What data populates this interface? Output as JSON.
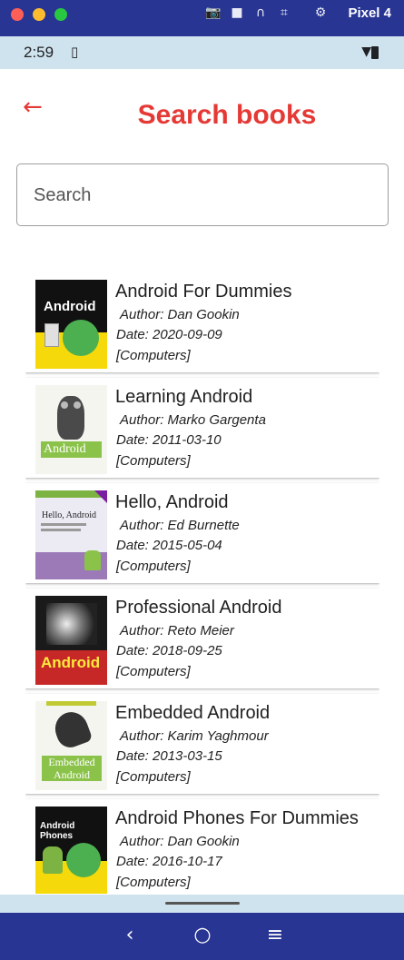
{
  "emulator": {
    "device_name": "Pixel 4",
    "icons": [
      "camera-icon",
      "video-icon",
      "headphones-icon",
      "screenshot-icon",
      "settings-icon"
    ]
  },
  "status_bar": {
    "time": "2:59"
  },
  "header": {
    "title": "Search books"
  },
  "search": {
    "placeholder": "Search"
  },
  "books": [
    {
      "title": "Android For Dummies",
      "author": "Author: Dan Gookin",
      "date": "Date: 2020-09-09",
      "category": "[Computers]",
      "cover_text": "Android"
    },
    {
      "title": "Learning Android",
      "author": "Author: Marko Gargenta",
      "date": "Date: 2011-03-10",
      "category": "[Computers]",
      "cover_text": "Android"
    },
    {
      "title": "Hello, Android",
      "author": "Author: Ed Burnette",
      "date": "Date: 2015-05-04",
      "category": "[Computers]",
      "cover_text": "Hello, Android"
    },
    {
      "title": "Professional Android",
      "author": "Author: Reto Meier",
      "date": "Date: 2018-09-25",
      "category": "[Computers]",
      "cover_text": "Android"
    },
    {
      "title": "Embedded Android",
      "author": "Author: Karim Yaghmour",
      "date": "Date: 2013-03-15",
      "category": "[Computers]",
      "cover_text": "Embedded Android"
    },
    {
      "title": "Android Phones For Dummies",
      "author": "Author: Dan Gookin",
      "date": "Date: 2016-10-17",
      "category": "[Computers]",
      "cover_text": "Android Phones"
    }
  ],
  "colors": {
    "accent": "#e53935",
    "system_bar": "#283593",
    "status_bar": "#cfe3ee"
  }
}
